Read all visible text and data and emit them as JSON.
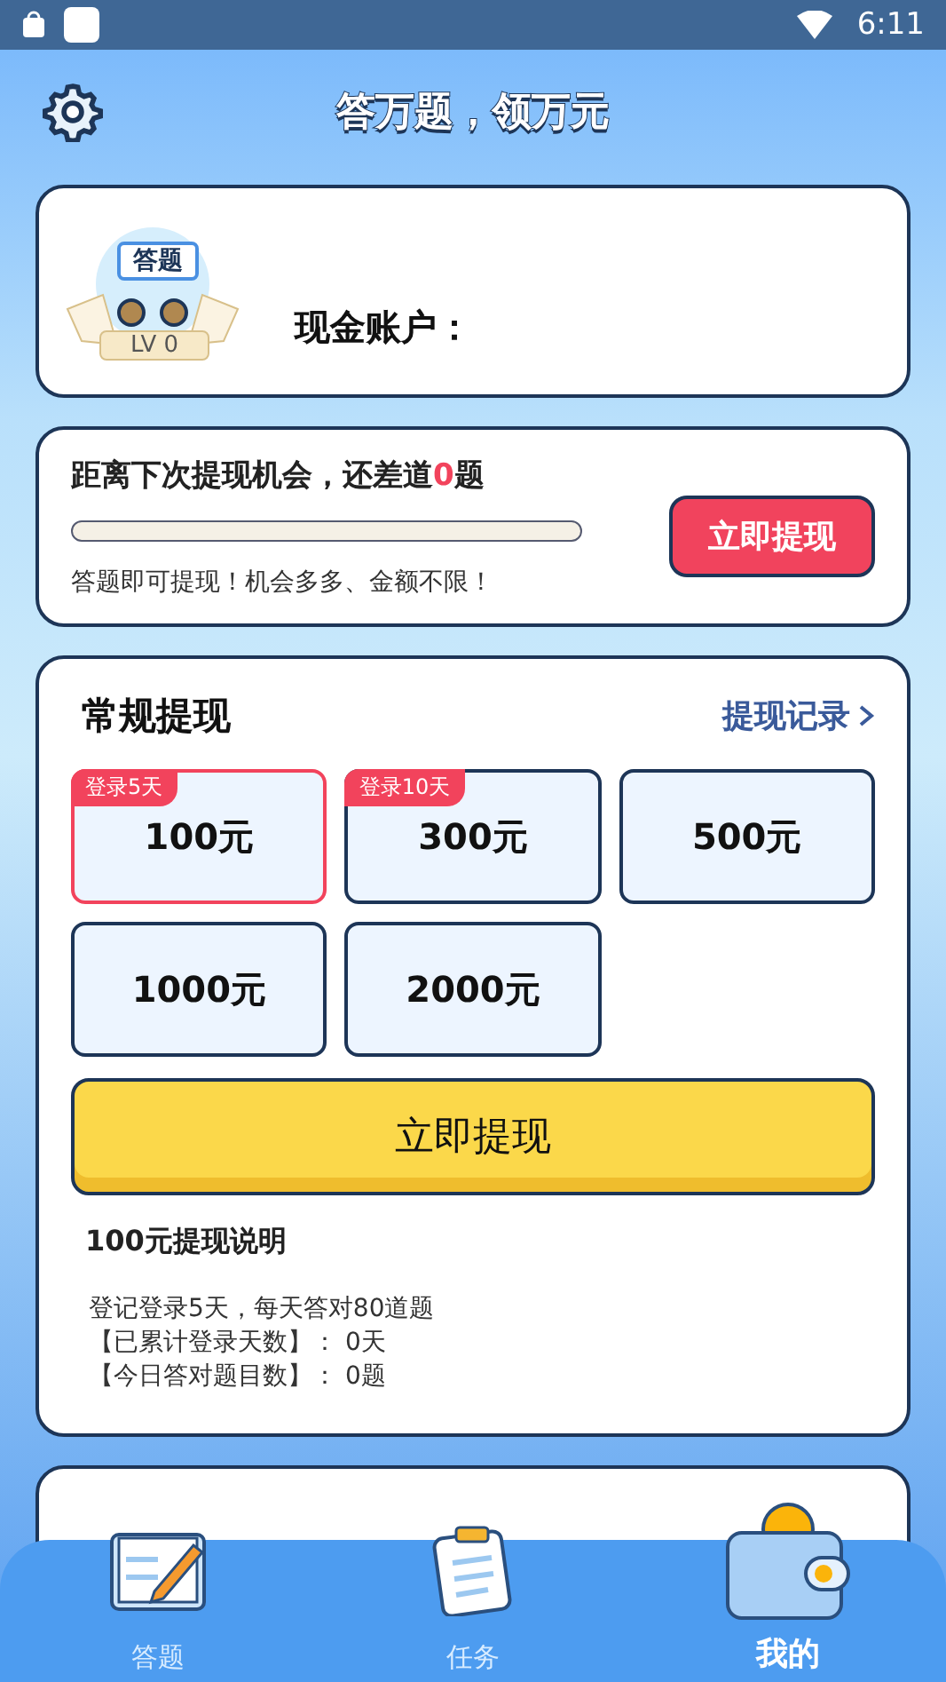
{
  "status_bar": {
    "time": "6:11"
  },
  "header": {
    "title": "答万题，领万元"
  },
  "account": {
    "badge_text": "答题",
    "level": "LV 0",
    "label": "现金账户："
  },
  "progress_card": {
    "title_prefix": "距离下次提现机会，还差道",
    "count": "0",
    "title_suffix": "题",
    "level": 0,
    "button": "立即提现",
    "note": "答题即可提现！机会多多、金额不限！"
  },
  "withdraw": {
    "title": "常规提现",
    "history_link": "提现记录",
    "amounts": [
      {
        "label": "100元",
        "tag": "登录5天",
        "selected": true
      },
      {
        "label": "300元",
        "tag": "登录10天",
        "selected": false
      },
      {
        "label": "500元",
        "selected": false
      },
      {
        "label": "1000元",
        "selected": false
      },
      {
        "label": "2000元",
        "selected": false
      }
    ],
    "button": "立即提现",
    "info_title": "100元提现说明",
    "info_lines": [
      "登记登录5天，每天答对80道题",
      "【已累计登录天数】： 0天",
      "【今日答对题目数】： 0题"
    ]
  },
  "bottom_nav": [
    {
      "label": "答题",
      "kind": "quiz",
      "selected": false
    },
    {
      "label": "任务",
      "kind": "task",
      "selected": false
    },
    {
      "label": "我的",
      "kind": "wallet",
      "selected": true
    }
  ]
}
